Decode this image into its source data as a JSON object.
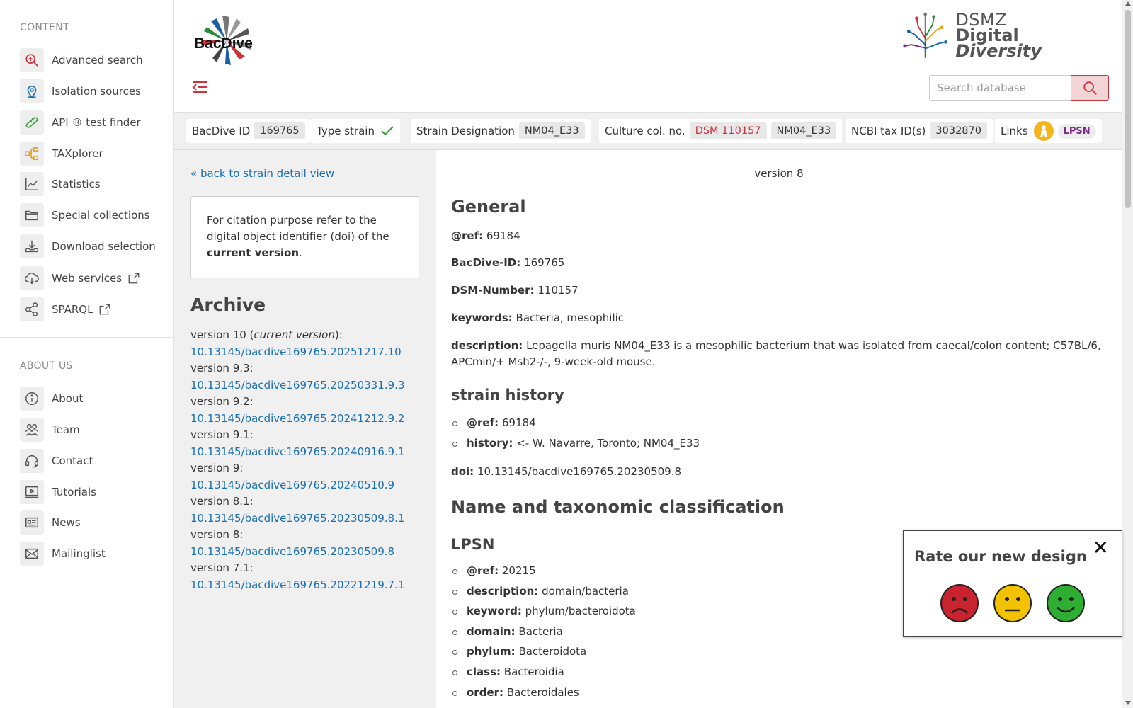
{
  "sidebar": {
    "content_title": "CONTENT",
    "about_title": "ABOUT US",
    "content_items": [
      {
        "label": "Advanced search",
        "icon": "magnifier-plus-icon"
      },
      {
        "label": "Isolation sources",
        "icon": "location-pin-icon"
      },
      {
        "label": "API ® test finder",
        "icon": "test-strip-icon"
      },
      {
        "label": "TAXplorer",
        "icon": "hierarchy-icon"
      },
      {
        "label": "Statistics",
        "icon": "line-chart-icon"
      },
      {
        "label": "Special collections",
        "icon": "folder-icon"
      },
      {
        "label": "Download selection",
        "icon": "download-icon"
      },
      {
        "label": "Web services",
        "icon": "cloud-download-icon"
      },
      {
        "label": "SPARQL",
        "icon": "share-nodes-icon"
      }
    ],
    "about_items": [
      {
        "label": "About",
        "icon": "info-icon"
      },
      {
        "label": "Team",
        "icon": "team-icon"
      },
      {
        "label": "Contact",
        "icon": "headset-icon"
      },
      {
        "label": "Tutorials",
        "icon": "video-icon"
      },
      {
        "label": "News",
        "icon": "newspaper-icon"
      },
      {
        "label": "Mailinglist",
        "icon": "envelope-icon"
      }
    ]
  },
  "header": {
    "logo_text": "BacDive",
    "dsmz_line1": "DSMZ",
    "dsmz_line2a": "Digital ",
    "dsmz_line2b": "Diversity",
    "search_placeholder": "Search database"
  },
  "infobar": {
    "bacdive_id_label": "BacDive ID",
    "bacdive_id": "169765",
    "type_strain_label": "Type strain",
    "strain_designation_label": "Strain Designation",
    "strain_designation": "NM04_E33",
    "culture_label": "Culture col. no.",
    "culture_numbers": [
      "DSM 110157",
      "NM04_E33"
    ],
    "ncbi_label": "NCBI tax ID(s)",
    "ncbi_id": "3032870",
    "links_label": "Links",
    "lpsn_label": "LPSN"
  },
  "left": {
    "back_link": "« back to strain detail view",
    "citation_a": "For citation purpose refer to the digital object identifier (doi) of the ",
    "citation_b": "current version",
    "citation_c": ".",
    "archive_title": "Archive",
    "archive": [
      {
        "label": "version 10 (",
        "label_italic": "current version",
        "label_end": "):",
        "doi": "10.13145/bacdive169765.20251217.10"
      },
      {
        "label": "version 9.3:",
        "doi": "10.13145/bacdive169765.20250331.9.3"
      },
      {
        "label": "version 9.2:",
        "doi": "10.13145/bacdive169765.20241212.9.2"
      },
      {
        "label": "version 9.1:",
        "doi": "10.13145/bacdive169765.20240916.9.1"
      },
      {
        "label": "version 9:",
        "doi": "10.13145/bacdive169765.20240510.9"
      },
      {
        "label": "version 8.1:",
        "doi": "10.13145/bacdive169765.20230509.8.1"
      },
      {
        "label": "version 8:",
        "doi": "10.13145/bacdive169765.20230509.8"
      },
      {
        "label": "version 7.1:",
        "doi": "10.13145/bacdive169765.20221219.7.1"
      }
    ]
  },
  "main": {
    "version": "version 8",
    "general_title": "General",
    "ref_label": "@ref:",
    "ref_value": "69184",
    "bacdive_label": "BacDive-ID:",
    "bacdive_value": "169765",
    "dsm_label": "DSM-Number:",
    "dsm_value": "110157",
    "keywords_label": "keywords:",
    "keywords_value": "Bacteria, mesophilic",
    "description_label": "description:",
    "description_value": "Lepagella muris NM04_E33 is a mesophilic bacterium that was isolated from caecal/colon content; C57BL/6, APCmin/+ Msh2-/-, 9-week-old mouse.",
    "strain_history_title": "strain history",
    "strain_history": [
      {
        "label": "@ref:",
        "value": "69184"
      },
      {
        "label": "history:",
        "value": "<- W. Navarre, Toronto; NM04_E33"
      }
    ],
    "doi_label": "doi:",
    "doi_value": "10.13145/bacdive169765.20230509.8",
    "taxonomy_title": "Name and taxonomic classification",
    "lpsn_title": "LPSN",
    "lpsn": [
      {
        "label": "@ref:",
        "value": "20215"
      },
      {
        "label": "description:",
        "value": "domain/bacteria"
      },
      {
        "label": "keyword:",
        "value": "phylum/bacteroidota"
      },
      {
        "label": "domain:",
        "value": "Bacteria"
      },
      {
        "label": "phylum:",
        "value": "Bacteroidota"
      },
      {
        "label": "class:",
        "value": "Bacteroidia"
      },
      {
        "label": "order:",
        "value": "Bacteroidales"
      }
    ]
  },
  "rating": {
    "title": "Rate our new design",
    "close": "✕",
    "faces": [
      {
        "name": "sad-face-icon",
        "color": "#c9232d"
      },
      {
        "name": "neutral-face-icon",
        "color": "#f2c200"
      },
      {
        "name": "happy-face-icon",
        "color": "#2fae33"
      }
    ]
  },
  "colors": {
    "brand_red": "#c9343f",
    "link_blue": "#1a6fb0",
    "icon_red": "#c9343f",
    "icon_blue": "#1a6fb0",
    "icon_green": "#3d9a3d",
    "icon_orange": "#e8a317"
  }
}
